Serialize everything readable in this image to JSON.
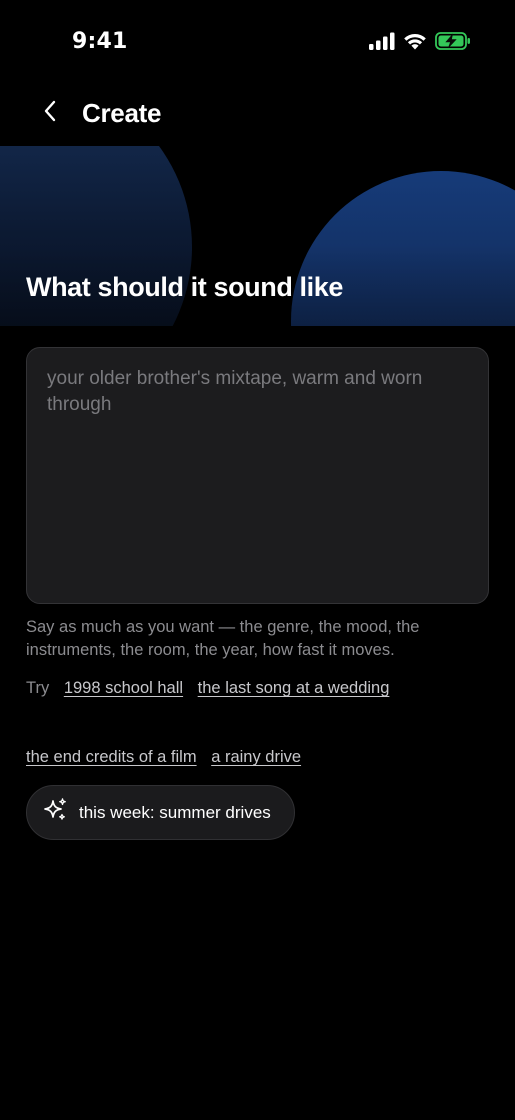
{
  "status_bar": {
    "time": "9:41",
    "icons": [
      "cellular-signal",
      "wifi",
      "battery-charging"
    ],
    "battery_color": "#34c759"
  },
  "nav": {
    "back_icon": "chevron-left",
    "title": "Create"
  },
  "hero": {
    "title": "What should it sound like",
    "accent_color": "#163b79"
  },
  "prompt": {
    "value": "",
    "placeholder": "your older brother's mixtape, warm and worn through"
  },
  "helper_text": "Say as much as you want — the genre, the mood, the instruments, the room, the year, how fast it moves.",
  "suggestions": {
    "try_label": "Try",
    "items": [
      "1998 school hall",
      "the last song at a wedding",
      "the end credits of a film",
      "a rainy drive"
    ]
  },
  "theme_chip": {
    "icon": "sparkles",
    "label": "this week: summer drives"
  }
}
